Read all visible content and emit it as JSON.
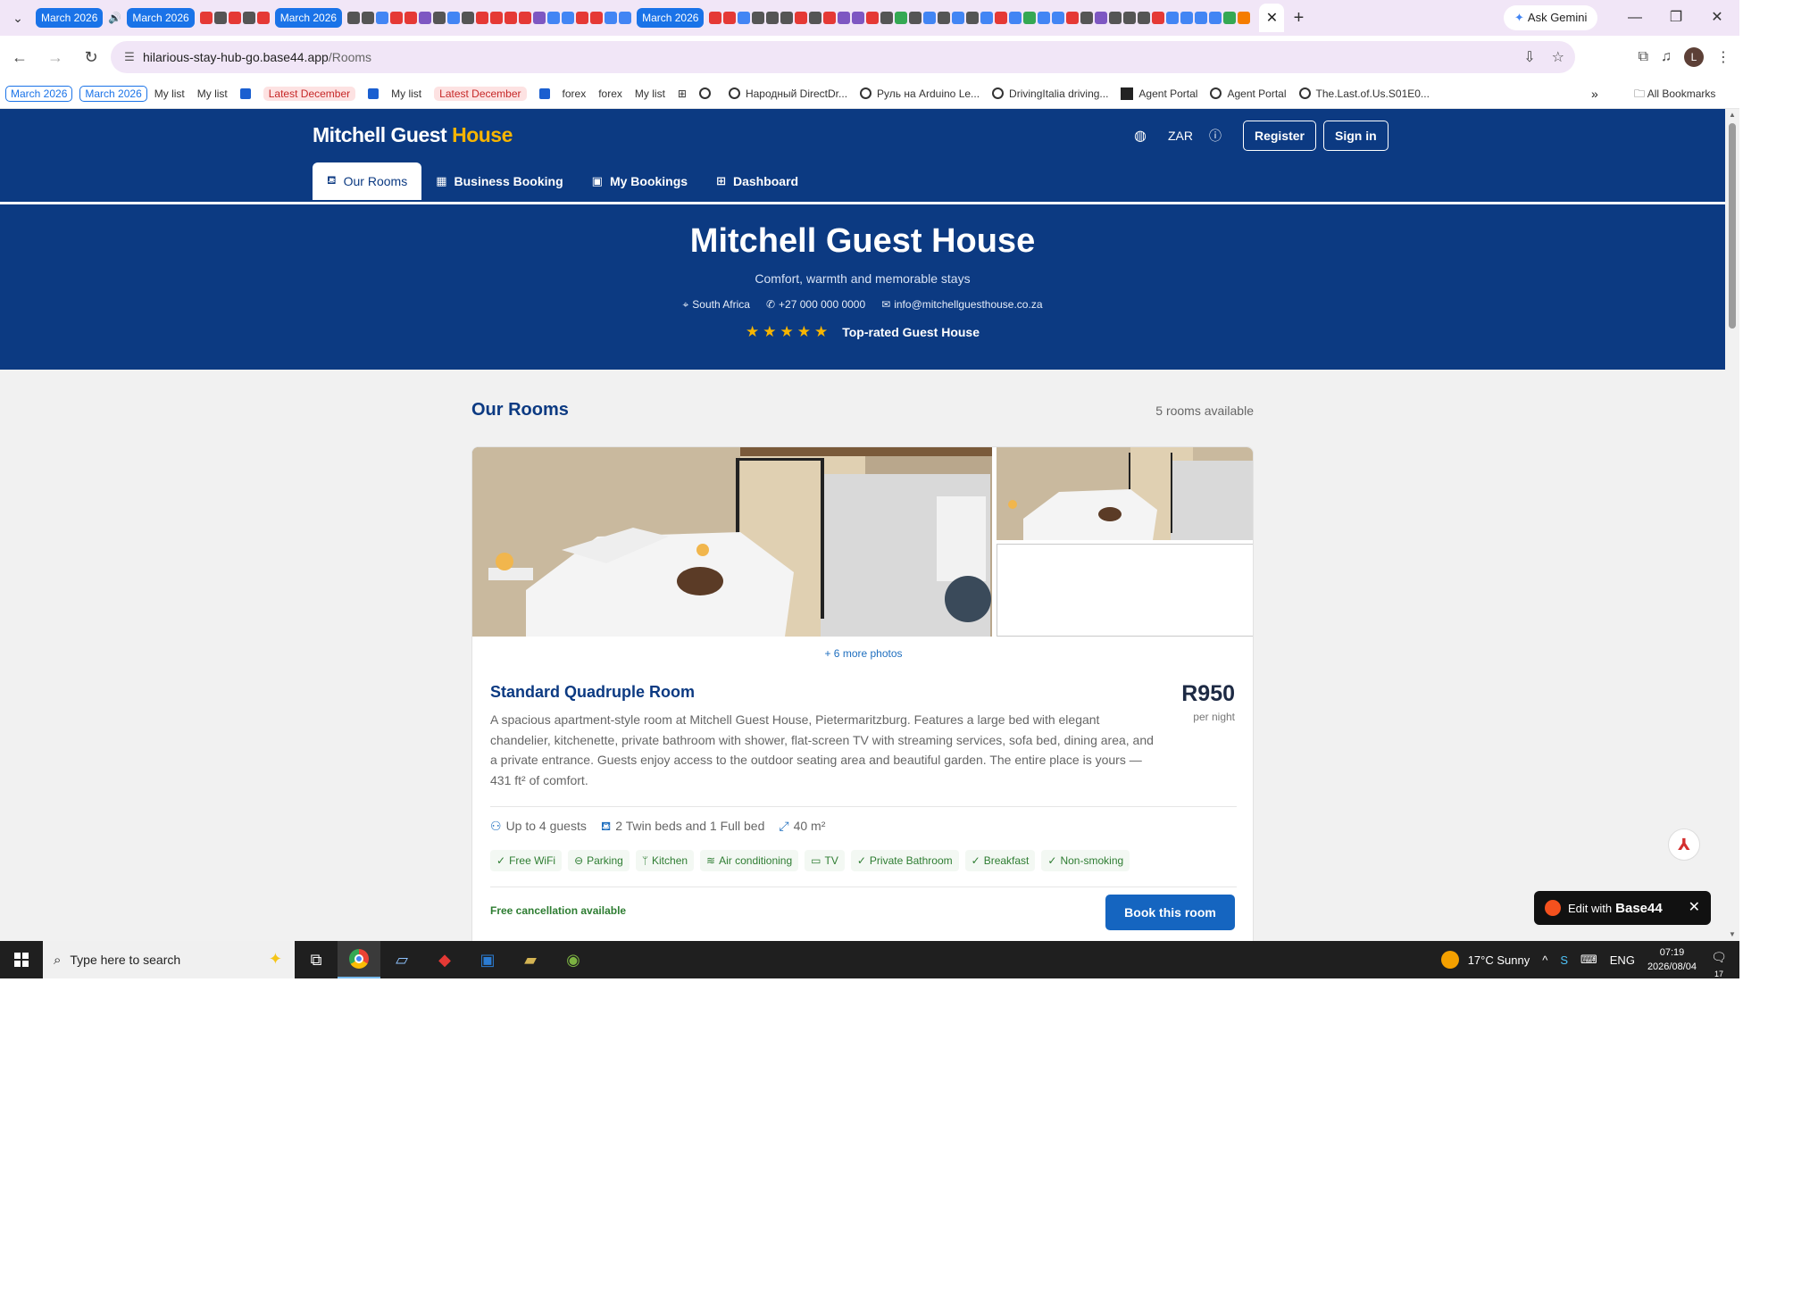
{
  "browser": {
    "tab_groups": [
      "March 2026",
      "March 2026",
      "March 2026",
      "March 2026"
    ],
    "active_tab_icon": "base44-icon",
    "gemini_label": "Ask Gemini",
    "url_host": "hilarious-stay-hub-go.base44.app",
    "url_path": "/Rooms",
    "bookmarks": [
      "March 2026",
      "March 2026",
      "My list",
      "My list",
      "Latest December",
      "My list",
      "Latest December",
      "forex",
      "forex",
      "My list",
      "Народный DirectDr...",
      "Руль на Arduino Le...",
      "DrivingItalia driving...",
      "Agent Portal",
      "Agent Portal",
      "The.Last.of.Us.S01E0..."
    ],
    "all_bookmarks": "All Bookmarks"
  },
  "site": {
    "brand_main": "Mitchell Guest",
    "brand_accent": "House",
    "currency": "ZAR",
    "register": "Register",
    "sign_in": "Sign in",
    "nav": [
      "Our Rooms",
      "Business Booking",
      "My Bookings",
      "Dashboard"
    ]
  },
  "hero": {
    "title": "Mitchell Guest House",
    "subtitle": "Comfort, warmth and memorable stays",
    "location": "South Africa",
    "phone": "+27 000 000 0000",
    "email": "info@mitchellguesthouse.co.za",
    "rating_stars": 5,
    "rating_label": "Top-rated Guest House"
  },
  "rooms": {
    "title": "Our Rooms",
    "count": "5 rooms available",
    "room": {
      "more_photos": "+ 6 more photos",
      "name": "Standard Quadruple Room",
      "description": "A spacious apartment-style room at Mitchell Guest House, Pietermaritzburg. Features a large bed with elegant chandelier, kitchenette, private bathroom with shower, flat-screen TV with streaming services, sofa bed, dining area, and a private entrance. Guests enjoy access to the outdoor seating area and beautiful garden. The entire place is yours — 431 ft² of comfort.",
      "price": "R950",
      "price_unit": "per night",
      "guests": "Up to 4 guests",
      "beds": "2 Twin beds and 1 Full bed",
      "size": "40 m²",
      "amenities": [
        "Free WiFi",
        "Parking",
        "Kitchen",
        "Air conditioning",
        "TV",
        "Private Bathroom",
        "Breakfast",
        "Non-smoking"
      ],
      "cancellation": "Free cancellation available",
      "book_button": "Book this room"
    }
  },
  "overlay": {
    "edit_with": "Edit with",
    "edit_brand": "Base44"
  },
  "taskbar": {
    "search_placeholder": "Type here to search",
    "weather": "17°C  Sunny",
    "language": "ENG",
    "time": "07:19",
    "date": "2026/08/04",
    "notifications": "17"
  },
  "colors": {
    "header_blue": "#0c3a82",
    "accent_gold": "#f7b500",
    "button_blue": "#1565c0",
    "amenity_green": "#2e7d32"
  }
}
